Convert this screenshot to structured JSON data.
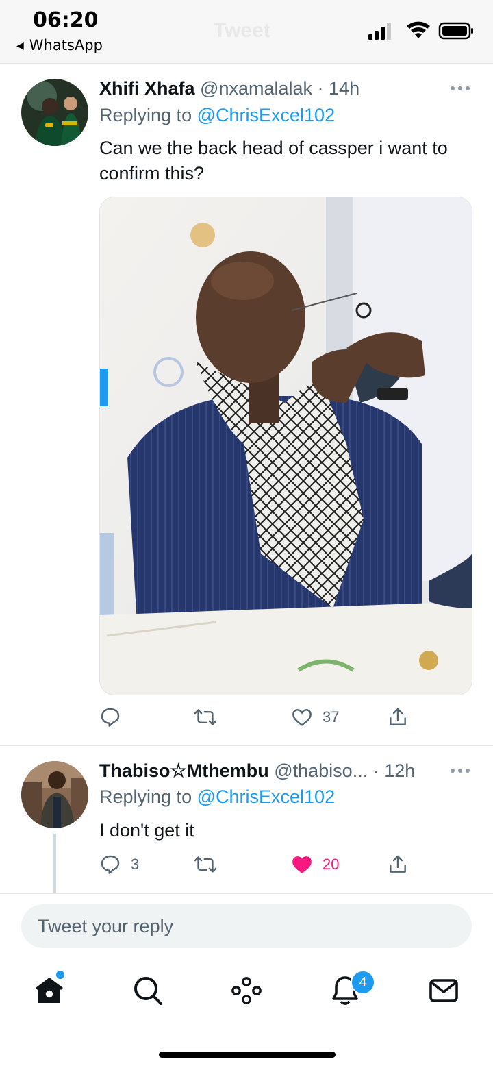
{
  "status_bar": {
    "time": "06:20",
    "back_app": "WhatsApp",
    "faded_title": "Tweet",
    "icons": [
      "signal-icon",
      "wifi-icon",
      "battery-icon"
    ]
  },
  "tweets": [
    {
      "name": "Xhifi Xhafa",
      "handle": "@nxamalalak",
      "time": "14h",
      "replying_prefix": "Replying to",
      "replying_to": "@ChrisExcel102",
      "text": "Can we the back head of cassper i want to confirm this?",
      "has_media": true,
      "replies": "",
      "retweets": "",
      "likes": "37",
      "liked": false
    },
    {
      "name": "Thabiso☆Mthembu",
      "handle": "@thabiso...",
      "time": "12h",
      "replying_prefix": "Replying to",
      "replying_to": "@ChrisExcel102",
      "text": "I don't get it",
      "has_media": false,
      "replies": "3",
      "retweets": "",
      "likes": "20",
      "liked": true
    }
  ],
  "composer": {
    "placeholder": "Tweet your reply"
  },
  "tab_bar": {
    "items": [
      "home-icon",
      "search-icon",
      "spaces-icon",
      "notifications-icon",
      "messages-icon"
    ],
    "notification_count": "4"
  },
  "colors": {
    "accent": "#1d9bf0",
    "like": "#f91880",
    "text": "#0f1419",
    "muted": "#536471"
  }
}
